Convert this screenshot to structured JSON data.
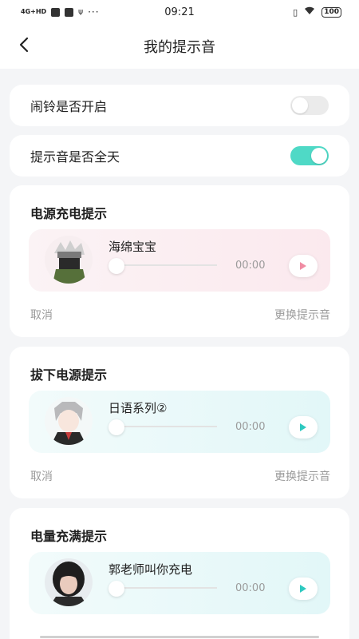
{
  "status_bar": {
    "network": "4G+HD",
    "time": "09:21",
    "dots": "···",
    "battery": "100"
  },
  "header": {
    "title": "我的提示音"
  },
  "toggles": [
    {
      "label": "闹铃是否开启",
      "enabled": false
    },
    {
      "label": "提示音是否全天",
      "enabled": true
    }
  ],
  "sections": [
    {
      "title": "电源充电提示",
      "sound_name": "海绵宝宝",
      "time": "00:00",
      "cancel": "取消",
      "change": "更换提示音",
      "theme": "pink"
    },
    {
      "title": "拔下电源提示",
      "sound_name": "日语系列②",
      "time": "00:00",
      "cancel": "取消",
      "change": "更换提示音",
      "theme": "cyan"
    },
    {
      "title": "电量充满提示",
      "sound_name": "郭老师叫你充电",
      "time": "00:00",
      "theme": "cyan"
    }
  ],
  "colors": {
    "toggle_on": "#4fd9c6",
    "toggle_off": "#ebebeb",
    "play_pink": "#f08ca3",
    "play_cyan": "#2ec9c0",
    "muted_text": "#9b9b9b"
  },
  "icons": {
    "back": "chevron-left-icon",
    "play": "play-icon"
  }
}
